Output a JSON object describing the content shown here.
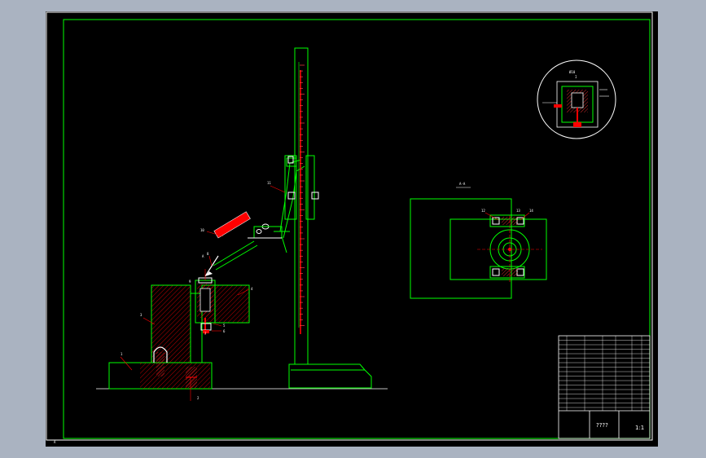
{
  "drawing": {
    "title_block_name": "????",
    "scale": "1:1",
    "view_label": "A-A",
    "detail_label": "I",
    "arrow_label": "A",
    "dimension_note": "Ø10",
    "part_numbers": [
      "1",
      "2",
      "3",
      "4",
      "5",
      "6",
      "7",
      "8",
      "9",
      "10",
      "11",
      "12",
      "13",
      "14"
    ],
    "corner_mark": "A"
  },
  "colors": {
    "background": "#000000",
    "frame": "#00ff00",
    "leader": "#ff0000",
    "text": "#ffffff",
    "hatch": "#ff0000",
    "window_bg": "#aab3c1"
  }
}
